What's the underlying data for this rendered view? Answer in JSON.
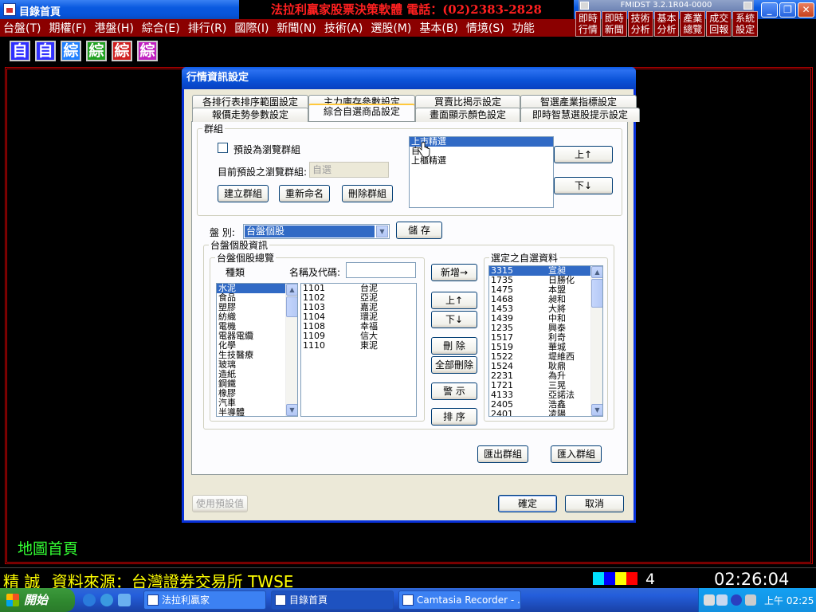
{
  "window": {
    "title": "目錄首頁",
    "brand_banner": "法拉利贏家股票決策軟體  電話：(02)2383-2828",
    "fmi_label": "FMIDST 3.2.1R04-0000",
    "controls": {
      "minimize": "_",
      "maximize": "❐",
      "close": "✕",
      "fmi_min": "-",
      "fmi_close": "-"
    }
  },
  "menubar": [
    "台盤(T)",
    "期權(F)",
    "港盤(H)",
    "綜合(E)",
    "排行(R)",
    "國際(I)",
    "新聞(N)",
    "技術(A)",
    "選股(M)",
    "基本(B)",
    "情境(S)",
    "功能"
  ],
  "quickbar": [
    {
      "label": "即時行情"
    },
    {
      "label": "即時新聞"
    },
    {
      "label": "技術分析"
    },
    {
      "label": "基本分析"
    },
    {
      "label": "產業總覽"
    },
    {
      "label": "成交回報"
    },
    {
      "label": "系統設定"
    }
  ],
  "toolbar": [
    {
      "label": "自",
      "color": "#3030ff"
    },
    {
      "label": "自",
      "color": "#3030ff"
    },
    {
      "label": "綜",
      "color": "#2080ff"
    },
    {
      "label": "綜",
      "color": "#20a020"
    },
    {
      "label": "綜",
      "color": "#d02020"
    },
    {
      "label": "綜",
      "color": "#c020c0"
    }
  ],
  "main": {
    "map_home": "地圖首頁"
  },
  "statusbar": {
    "left_a": "精 誠",
    "left_b": "資料來源：台灣證券交易所 TWSE",
    "colors": [
      "#00e0ff",
      "#0000ff",
      "#ffff00",
      "#ff0000"
    ],
    "count": "4",
    "clock": "02:26:04"
  },
  "taskbar": {
    "start": "開始",
    "tasks": [
      {
        "label": "法拉利贏家",
        "active": false
      },
      {
        "label": "目錄首頁",
        "active": true
      },
      {
        "label": "Camtasia Recorder - ...",
        "active": false
      }
    ],
    "clock": "上午 02:25"
  },
  "dialog": {
    "title": "行情資訊設定",
    "tabs_row1": [
      "各排行表排序範圍設定",
      "主力庫存參數設定",
      "買賣比揭示設定",
      "智選產業指標設定"
    ],
    "tabs_row2": [
      "報價走勢參數設定",
      "綜合自選商品設定",
      "畫面顯示顏色設定",
      "即時智慧選股提示設定"
    ],
    "group": {
      "legend": "群組",
      "default_browse_checkbox": "預設為瀏覽群組",
      "current_default_label": "目前預設之瀏覽群組:",
      "current_default_value": "自選",
      "create": "建立群組",
      "rename": "重新命名",
      "delete": "刪除群組",
      "list": [
        "上市精選",
        "自選",
        "上櫃精選"
      ],
      "up": "上↑",
      "down": "下↓"
    },
    "market_label": "盤 別:",
    "market_value": "台盤個股",
    "save": "儲 存",
    "stock_info_legend": "台盤個股資訊",
    "overview_legend": "台盤個股總覽",
    "category_header": "種類",
    "name_code_label": "名稱及代碼:",
    "name_code_value": "",
    "categories": [
      "水泥",
      "食品",
      "塑膠",
      "紡織",
      "電機",
      "電器電纜",
      "化學",
      "生技醫療",
      "玻璃",
      "造紙",
      "鋼鐵",
      "橡膠",
      "汽車",
      "半導體"
    ],
    "stocks": [
      {
        "code": "1101",
        "name": "台泥"
      },
      {
        "code": "1102",
        "name": "亞泥"
      },
      {
        "code": "1103",
        "name": "嘉泥"
      },
      {
        "code": "1104",
        "name": "環泥"
      },
      {
        "code": "1108",
        "name": "幸福"
      },
      {
        "code": "1109",
        "name": "信大"
      },
      {
        "code": "1110",
        "name": "東泥"
      }
    ],
    "mid_buttons": {
      "add": "新增→",
      "up": "上↑",
      "down": "下↓",
      "delete": "刪 除",
      "delete_all": "全部刪除",
      "alert": "警 示",
      "sort": "排 序"
    },
    "selected_legend": "選定之自選資料",
    "selected": [
      {
        "code": "3315",
        "name": "宣昶"
      },
      {
        "code": "1735",
        "name": "日勝化"
      },
      {
        "code": "1475",
        "name": "本盟"
      },
      {
        "code": "1468",
        "name": "昶和"
      },
      {
        "code": "1453",
        "name": "大將"
      },
      {
        "code": "1439",
        "name": "中和"
      },
      {
        "code": "1235",
        "name": "興泰"
      },
      {
        "code": "1517",
        "name": "利奇"
      },
      {
        "code": "1519",
        "name": "華城"
      },
      {
        "code": "1522",
        "name": "堤維西"
      },
      {
        "code": "1524",
        "name": "耿鼎"
      },
      {
        "code": "2231",
        "name": "為升"
      },
      {
        "code": "1721",
        "name": "三晃"
      },
      {
        "code": "4133",
        "name": "亞諾法"
      },
      {
        "code": "2405",
        "name": "浩鑫"
      },
      {
        "code": "2401",
        "name": "凌陽"
      }
    ],
    "export_group": "匯出群組",
    "import_group": "匯入群組",
    "use_default": "使用預設值",
    "ok": "確定",
    "cancel": "取消"
  }
}
